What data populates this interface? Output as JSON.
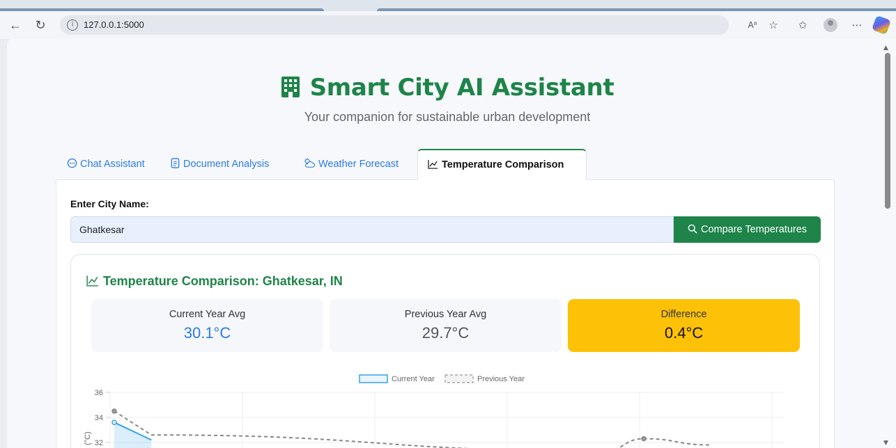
{
  "browser": {
    "url": "127.0.0.1:5000"
  },
  "header": {
    "title": "Smart City AI Assistant",
    "subtitle": "Your companion for sustainable urban development"
  },
  "tabs": [
    {
      "label": "Chat Assistant",
      "icon": "chat-icon"
    },
    {
      "label": "Document Analysis",
      "icon": "document-icon"
    },
    {
      "label": "Weather Forecast",
      "icon": "cloud-sun-icon"
    },
    {
      "label": "Temperature Comparison",
      "icon": "chart-line-icon",
      "active": true
    }
  ],
  "form": {
    "label": "Enter City Name:",
    "city_value": "Ghatkesar",
    "button_label": "Compare Temperatures"
  },
  "result": {
    "title": "Temperature Comparison: Ghatkesar, IN",
    "stats": [
      {
        "label": "Current Year Avg",
        "value": "30.1°C",
        "color": "#2c7be5"
      },
      {
        "label": "Previous Year Avg",
        "value": "29.7°C",
        "color": "#555555"
      },
      {
        "label": "Difference",
        "value": "0.4°C",
        "color": "#111111"
      }
    ]
  },
  "chart_data": {
    "type": "line",
    "ylabel": "(°C)",
    "y_ticks": [
      36,
      34,
      32
    ],
    "series": [
      {
        "name": "Current Year",
        "color": "#36a2eb",
        "dashed": false,
        "points": [
          [
            0,
            33.6
          ],
          [
            0.28,
            32.2
          ]
        ]
      },
      {
        "name": "Previous Year",
        "color": "#888888",
        "dashed": true,
        "points": [
          [
            0,
            34.5
          ],
          [
            0.28,
            32.6
          ],
          [
            3.7,
            31.3
          ],
          [
            4.0,
            32.3
          ],
          [
            4.5,
            31.8
          ]
        ]
      }
    ]
  }
}
